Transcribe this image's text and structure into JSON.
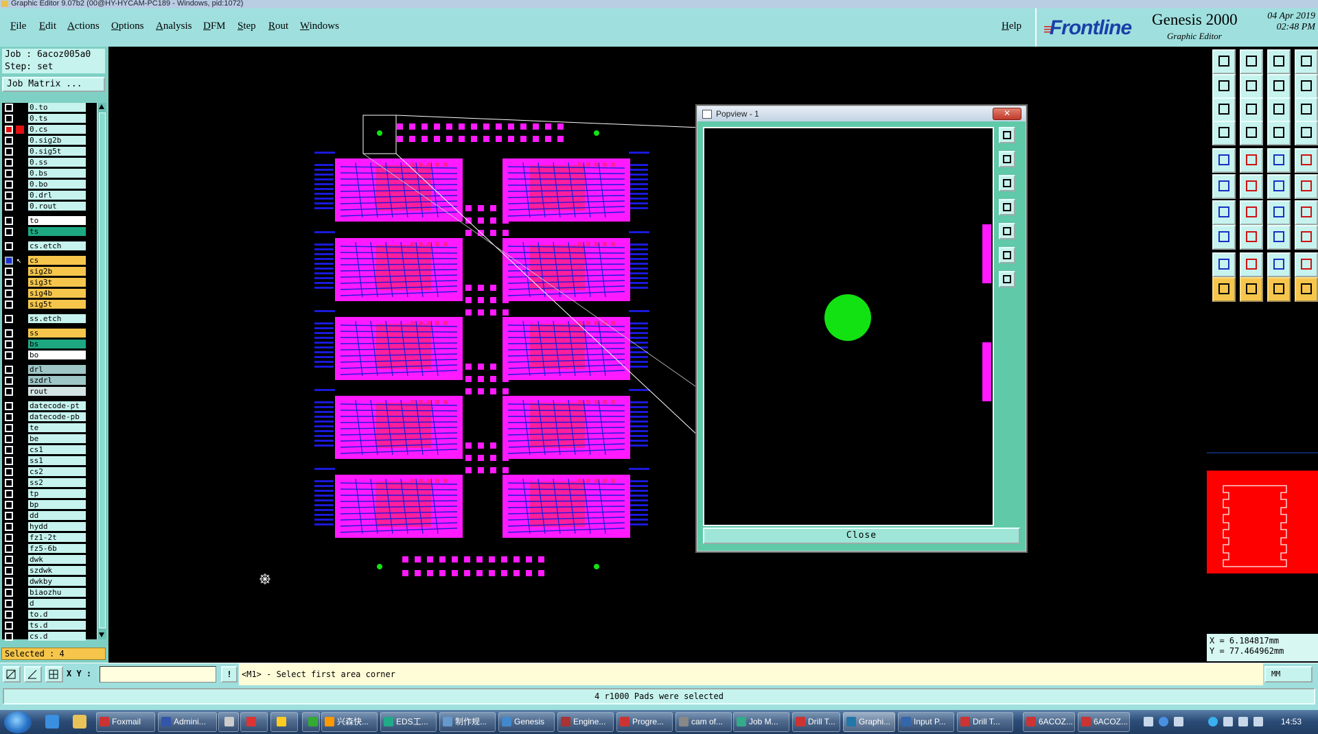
{
  "titlebar": {
    "text": "Graphic Editor 9.07b2 (00@HY-HYCAM-PC189 - Windows, pid:1072)"
  },
  "menu": [
    "File",
    "Edit",
    "Actions",
    "Options",
    "Analysis",
    "DFM",
    "Step",
    "Rout",
    "Windows"
  ],
  "help_label": "Help",
  "brand": {
    "logo_prefix": "F",
    "logo_rest": "rontline",
    "product": "Genesis 2000",
    "subtitle": "Graphic Editor",
    "date": "04 Apr 2019",
    "time": "02:48 PM"
  },
  "job": {
    "job_line": "Job : 6acoz005a0",
    "step_line": "Step: set",
    "matrix_label": "Job Matrix ..."
  },
  "layers": [
    {
      "name": "0.to",
      "color": "#c6f3ee",
      "cb": "normal"
    },
    {
      "name": "0.ts",
      "color": "#c6f3ee",
      "cb": "normal"
    },
    {
      "name": "0.cs",
      "color": "#c6f3ee",
      "cb": "red"
    },
    {
      "name": "0.sig2b",
      "color": "#c6f3ee",
      "cb": "normal"
    },
    {
      "name": "0.sig5t",
      "color": "#c6f3ee",
      "cb": "normal"
    },
    {
      "name": "0.ss",
      "color": "#c6f3ee",
      "cb": "normal"
    },
    {
      "name": "0.bs",
      "color": "#c6f3ee",
      "cb": "normal"
    },
    {
      "name": "0.bo",
      "color": "#c6f3ee",
      "cb": "normal"
    },
    {
      "name": "0.drl",
      "color": "#c6f3ee",
      "cb": "normal"
    },
    {
      "name": "0.rout",
      "color": "#c6f3ee",
      "cb": "normal"
    },
    {
      "name": "to",
      "color": "#ffffff",
      "cb": "normal"
    },
    {
      "name": "ts",
      "color": "#1ea882",
      "cb": "normal"
    },
    {
      "name": "cs.etch",
      "color": "#c6f3ee",
      "cb": "normal"
    },
    {
      "name": "cs",
      "color": "#f6c64c",
      "cb": "blue"
    },
    {
      "name": "sig2b",
      "color": "#f6c64c",
      "cb": "normal"
    },
    {
      "name": "sig3t",
      "color": "#f6c64c",
      "cb": "normal"
    },
    {
      "name": "sig4b",
      "color": "#f6c64c",
      "cb": "normal"
    },
    {
      "name": "sig5t",
      "color": "#f6c64c",
      "cb": "normal"
    },
    {
      "name": "ss.etch",
      "color": "#c6f3ee",
      "cb": "normal"
    },
    {
      "name": "ss",
      "color": "#f6c64c",
      "cb": "normal"
    },
    {
      "name": "bs",
      "color": "#1ea882",
      "cb": "normal"
    },
    {
      "name": "bo",
      "color": "#ffffff",
      "cb": "normal"
    },
    {
      "name": "drl",
      "color": "#9fc6c6",
      "cb": "normal"
    },
    {
      "name": "szdrl",
      "color": "#9fc6c6",
      "cb": "normal"
    },
    {
      "name": "rout",
      "color": "#d4e4e4",
      "cb": "normal"
    },
    {
      "name": "datecode-pt",
      "color": "#c6f3ee",
      "cb": "normal"
    },
    {
      "name": "datecode-pb",
      "color": "#c6f3ee",
      "cb": "normal"
    },
    {
      "name": "te",
      "color": "#c6f3ee",
      "cb": "normal"
    },
    {
      "name": "be",
      "color": "#c6f3ee",
      "cb": "normal"
    },
    {
      "name": "cs1",
      "color": "#c6f3ee",
      "cb": "normal"
    },
    {
      "name": "ss1",
      "color": "#c6f3ee",
      "cb": "normal"
    },
    {
      "name": "cs2",
      "color": "#c6f3ee",
      "cb": "normal"
    },
    {
      "name": "ss2",
      "color": "#c6f3ee",
      "cb": "normal"
    },
    {
      "name": "tp",
      "color": "#c6f3ee",
      "cb": "normal"
    },
    {
      "name": "bp",
      "color": "#c6f3ee",
      "cb": "normal"
    },
    {
      "name": "dd",
      "color": "#c6f3ee",
      "cb": "normal"
    },
    {
      "name": "hydd",
      "color": "#c6f3ee",
      "cb": "normal"
    },
    {
      "name": "fz1-2t",
      "color": "#c6f3ee",
      "cb": "normal"
    },
    {
      "name": "fz5-6b",
      "color": "#c6f3ee",
      "cb": "normal"
    },
    {
      "name": "dwk",
      "color": "#c6f3ee",
      "cb": "normal"
    },
    {
      "name": "szdwk",
      "color": "#c6f3ee",
      "cb": "normal"
    },
    {
      "name": "dwkby",
      "color": "#c6f3ee",
      "cb": "normal"
    },
    {
      "name": "biaozhu",
      "color": "#c6f3ee",
      "cb": "normal"
    },
    {
      "name": "d",
      "color": "#c6f3ee",
      "cb": "normal"
    },
    {
      "name": "to.d",
      "color": "#c6f3ee",
      "cb": "normal"
    },
    {
      "name": "ts.d",
      "color": "#c6f3ee",
      "cb": "normal"
    },
    {
      "name": "cs.d",
      "color": "#c6f3ee",
      "cb": "normal"
    }
  ],
  "selected": "Selected : 4",
  "popview": {
    "title": "Popview - 1",
    "close_label": "Close",
    "close_x": "✕"
  },
  "coords": {
    "x": "X = 6.184817mm",
    "y": "Y = 77.464962mm"
  },
  "cmd": {
    "xy_label": "X Y :",
    "xy_value": "",
    "prompt": "<M1> - Select first area corner",
    "units": "MM"
  },
  "status": "4 r1000 Pads were selected",
  "taskbar": {
    "tasks": [
      "Foxmail",
      "Admini...",
      "",
      "",
      "",
      "",
      "兴森快...",
      "EDS工...",
      "制作规...",
      "Genesis",
      "Engine...",
      "Progre...",
      "cam of...",
      "Job M...",
      "Drill T...",
      "Graphi...",
      "Input P...",
      "Drill T...",
      "6ACOZ...",
      "6ACOZ..."
    ],
    "clock": "14:53"
  },
  "colors": {
    "magenta": "#ff1aff",
    "pink": "#ff1e9b",
    "blue": "#1a1adc",
    "green": "#12e212"
  }
}
